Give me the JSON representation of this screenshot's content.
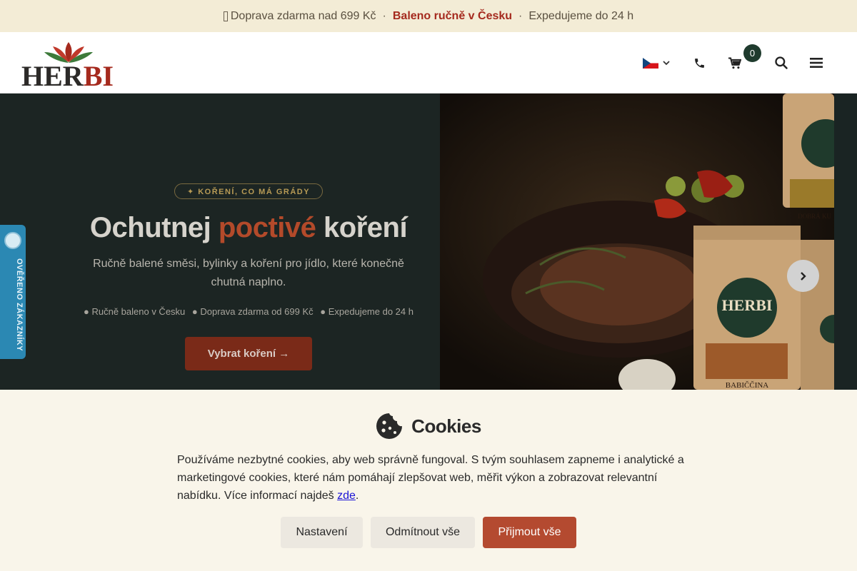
{
  "topbar": {
    "item1": "Doprava zdarma nad 699 Kč",
    "item2": "Baleno ručně v Česku",
    "item3": "Expedujeme do 24 h",
    "separator": "·"
  },
  "header": {
    "logo_text_main": "HER",
    "logo_text_accent": "BI",
    "cart_count": "0",
    "icons": [
      "cz-flag-icon",
      "chevron-down-icon",
      "phone-icon",
      "cart-icon",
      "search-icon",
      "menu-icon"
    ]
  },
  "hero": {
    "badge": "✦ KOŘENÍ, CO MÁ GRÁDY",
    "title_start": "Ochutnej ",
    "title_accent": "poctivé",
    "title_end": " koření",
    "subtitle": "Ručně balené směsi, bylinky a koření pro jídlo, které konečně chutná naplno.",
    "bullets": [
      "● Ručně baleno v Česku",
      "● Doprava zdarma od 699 Kč",
      "● Expedujeme do 24 h"
    ],
    "cta": "Vybrat koření →",
    "accent_color": "#b34a2a"
  },
  "side_tab": {
    "label": "OVĚŘENO ZÁKAZNÍKY"
  },
  "cookies": {
    "title": "Cookies",
    "text_before_link": "Používáme nezbytné cookies, aby web správně fungoval. S tvým souhlasem zapneme i analytické a marketingové cookies, které nám pomáhají zlepšovat web, měřit výkon a zobrazovat relevantní nabídku. Více informací najdeš ",
    "link": "zde",
    "text_after_link": ".",
    "buttons": {
      "settings": "Nastavení",
      "reject": "Odmítnout vše",
      "accept": "Přijmout vše"
    },
    "accept_color": "#b44a30"
  }
}
